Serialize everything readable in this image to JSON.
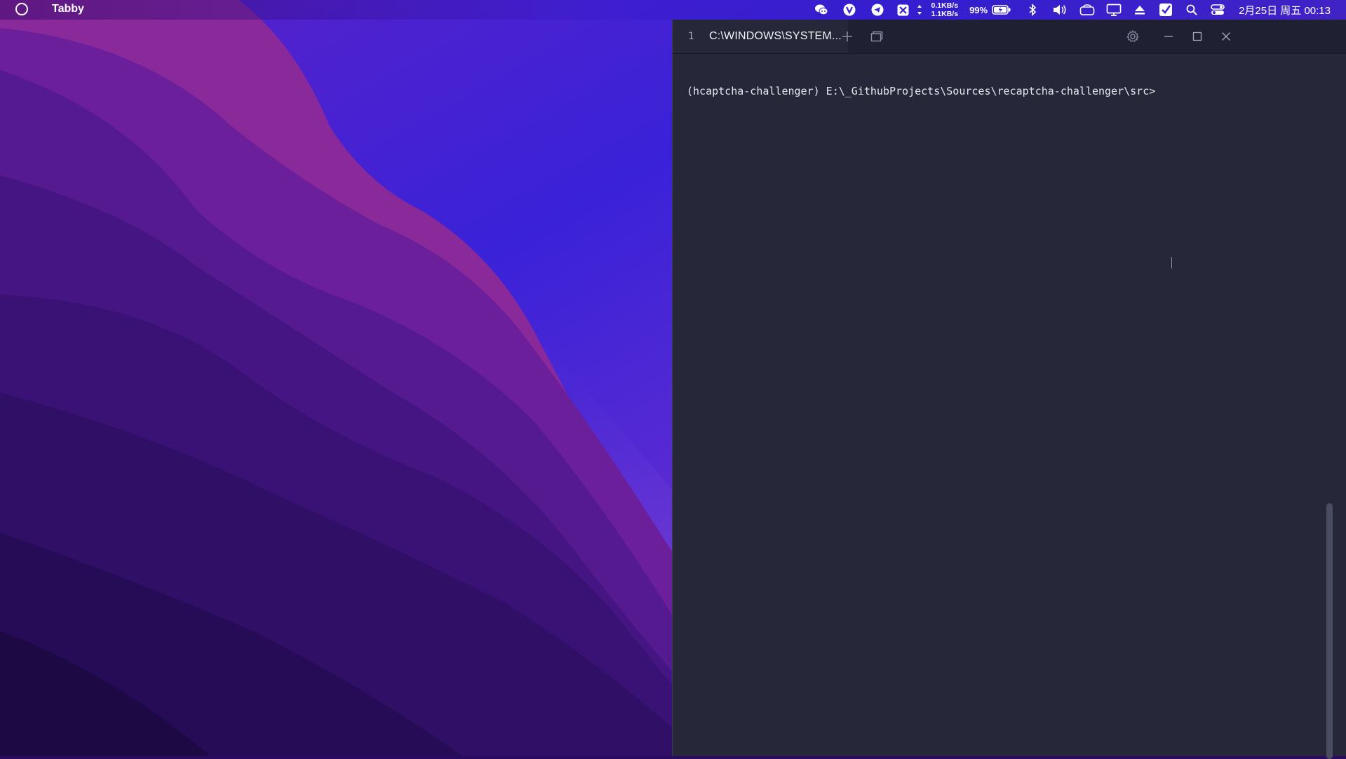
{
  "menubar": {
    "app_name": "Tabby",
    "net_up": "0.1KB/s",
    "net_down": "1.1KB/s",
    "battery_percent": "99%",
    "clock": "2月25日 周五 00:13",
    "tray_icons": [
      "wechat-icon",
      "v-app-icon",
      "telegram-icon",
      "xmind-icon",
      "network-arrows-icon",
      "battery-icon",
      "bluetooth-icon",
      "volume-icon",
      "cloud-drive-icon",
      "display-icon",
      "eject-icon",
      "checklist-icon",
      "search-icon",
      "control-center-icon"
    ]
  },
  "window": {
    "tab": {
      "index": "1",
      "title": "C:\\WINDOWS\\SYSTEM..."
    },
    "terminal": {
      "prompt": "(hcaptcha-challenger) E:\\_GithubProjects\\Sources\\recaptcha-challenger\\src>"
    },
    "scroll": {
      "position": 0.64
    }
  },
  "colors": {
    "terminal_bg": "#262839",
    "titlebar_bg": "#1f2132",
    "wallpaper_accent": "#3a1fd6"
  }
}
